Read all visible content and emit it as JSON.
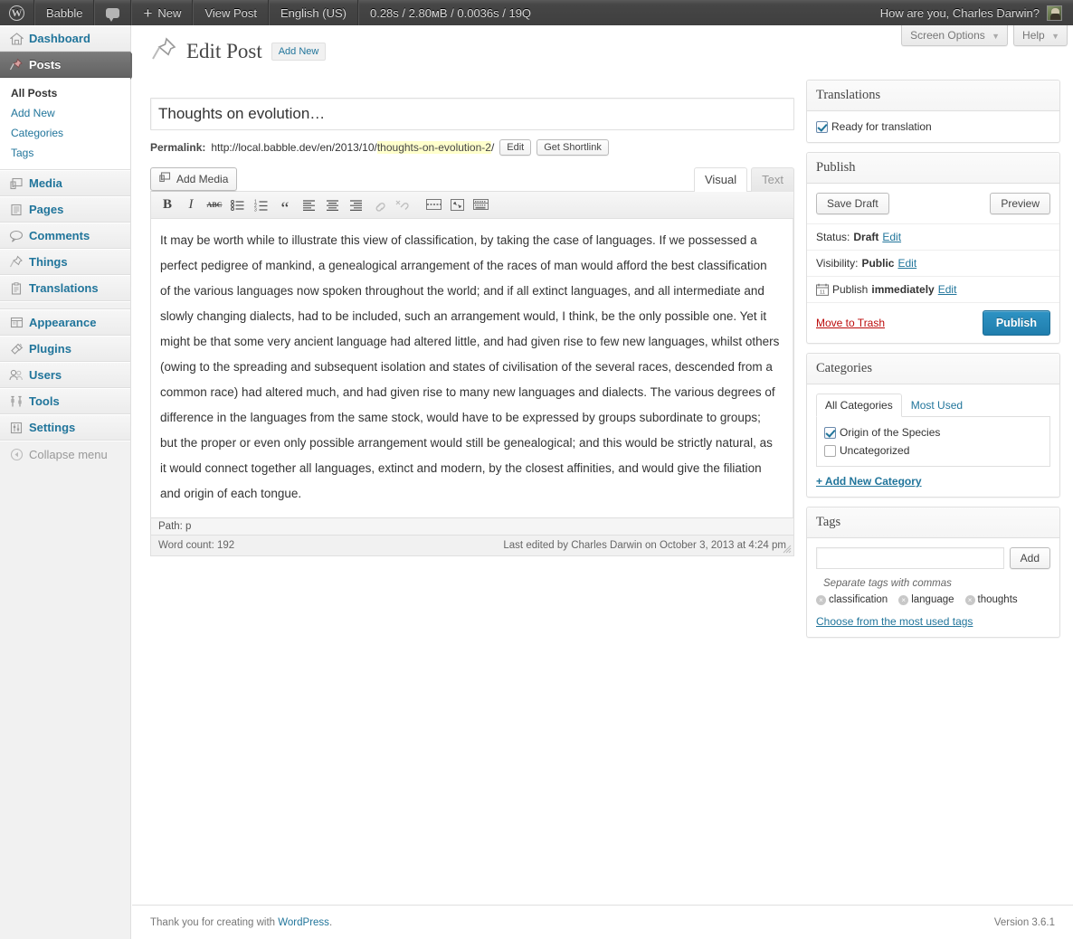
{
  "adminbar": {
    "logo_icon": "wordpress-logo-icon",
    "site_name": "Babble",
    "comments_icon": "comment-bubble-icon",
    "new_label": "New",
    "view_post_label": "View Post",
    "language_label": "English (US)",
    "debug_stats": "0.28s / 2.80мB / 0.0036s / 19Q",
    "greeting": "How are you, Charles Darwin?",
    "avatar_icon": "user-avatar-icon"
  },
  "screen_meta": {
    "screen_options_label": "Screen Options",
    "help_label": "Help",
    "caret": "▼"
  },
  "sidebar": {
    "items": [
      {
        "label": "Dashboard",
        "icon": "dashboard-home-icon",
        "current": false
      },
      {
        "label": "Posts",
        "icon": "pushpin-icon",
        "current": true
      },
      {
        "label": "Media",
        "icon": "media-images-icon",
        "current": false
      },
      {
        "label": "Pages",
        "icon": "pages-document-icon",
        "current": false
      },
      {
        "label": "Comments",
        "icon": "comment-bubble-icon",
        "current": false
      },
      {
        "label": "Things",
        "icon": "pushpin-icon",
        "current": false
      },
      {
        "label": "Translations",
        "icon": "clipboard-icon",
        "current": false
      },
      {
        "label": "Appearance",
        "icon": "appearance-layout-icon",
        "current": false
      },
      {
        "label": "Plugins",
        "icon": "plug-icon",
        "current": false
      },
      {
        "label": "Users",
        "icon": "users-icon",
        "current": false
      },
      {
        "label": "Tools",
        "icon": "tools-icon",
        "current": false
      },
      {
        "label": "Settings",
        "icon": "settings-sliders-icon",
        "current": false
      }
    ],
    "posts_submenu": [
      {
        "label": "All Posts",
        "current": true
      },
      {
        "label": "Add New",
        "current": false
      },
      {
        "label": "Categories",
        "current": false
      },
      {
        "label": "Tags",
        "current": false
      }
    ],
    "collapse_label": "Collapse menu",
    "collapse_icon": "collapse-arrow-icon"
  },
  "page": {
    "title": "Edit Post",
    "title_icon": "pushpin-icon",
    "add_new_label": "Add New"
  },
  "post": {
    "title_value": "Thoughts on evolution…",
    "title_placeholder": "Enter title here",
    "permalink_label": "Permalink:",
    "permalink_base": "http://local.babble.dev/en/2013/10/",
    "permalink_slug": "thoughts-on-evolution-2",
    "permalink_tail": "/",
    "edit_slug_label": "Edit",
    "shortlink_label": "Get Shortlink",
    "add_media_label": "Add Media",
    "add_media_icon": "add-media-icon",
    "tab_visual": "Visual",
    "tab_text": "Text",
    "active_tab": "Visual",
    "body_text": "It may be worth while to illustrate this view of classification, by taking the case of languages. If we possessed a perfect pedigree of mankind, a genealogical arrangement of the races of man would afford the best classification of the various languages now spoken throughout the world; and if all extinct languages, and all intermediate and slowly changing dialects, had to be included, such an arrangement would, I think, be the only possible one. Yet it might be that some very ancient language had altered little, and had given rise to few new languages, whilst others (owing to the spreading and subsequent isolation and states of civilisation of the several races, descended from a common race) had altered much, and had given rise to many new languages and dialects. The various degrees of difference in the languages from the same stock, would have to be expressed by groups subordinate to groups; but the proper or even only possible arrangement would still be genealogical; and this would be strictly natural, as it would connect together all languages, extinct and modern, by the closest affinities, and would give the filiation and origin of each tongue.",
    "path_label": "Path: p",
    "word_count_label": "Word count: 192",
    "last_edited_label": "Last edited by Charles Darwin on October 3, 2013 at 4:24 pm"
  },
  "toolbar_buttons": [
    {
      "name": "bold-icon",
      "glyph": "B"
    },
    {
      "name": "italic-icon",
      "glyph": "I"
    },
    {
      "name": "strikethrough-icon",
      "glyph": "ABC"
    },
    {
      "name": "unordered-list-icon",
      "glyph": ""
    },
    {
      "name": "ordered-list-icon",
      "glyph": ""
    },
    {
      "name": "blockquote-icon",
      "glyph": "“"
    },
    {
      "name": "align-left-icon",
      "glyph": ""
    },
    {
      "name": "align-center-icon",
      "glyph": ""
    },
    {
      "name": "align-right-icon",
      "glyph": ""
    },
    {
      "name": "insert-link-icon",
      "glyph": "",
      "disabled": true
    },
    {
      "name": "remove-link-icon",
      "glyph": "",
      "disabled": true
    },
    {
      "name": "insert-more-tag-icon",
      "glyph": ""
    },
    {
      "name": "fullscreen-icon",
      "glyph": ""
    },
    {
      "name": "kitchen-sink-icon",
      "glyph": ""
    }
  ],
  "translations_box": {
    "title": "Translations",
    "ready_label": "Ready for translation",
    "ready_checked": true
  },
  "publish_box": {
    "title": "Publish",
    "save_draft_label": "Save Draft",
    "preview_label": "Preview",
    "status_prefix": "Status:",
    "status_value": "Draft",
    "status_edit": "Edit",
    "visibility_prefix": "Visibility:",
    "visibility_value": "Public",
    "visibility_edit": "Edit",
    "schedule_icon": "calendar-icon",
    "schedule_prefix": "Publish",
    "schedule_value": "immediately",
    "schedule_edit": "Edit",
    "trash_label": "Move to Trash",
    "publish_label": "Publish"
  },
  "categories_box": {
    "title": "Categories",
    "tab_all": "All Categories",
    "tab_most_used": "Most Used",
    "active_tab": "All Categories",
    "items": [
      {
        "label": "Origin of the Species",
        "checked": true
      },
      {
        "label": "Uncategorized",
        "checked": false
      }
    ],
    "add_new_label": "+ Add New Category"
  },
  "tags_box": {
    "title": "Tags",
    "input_value": "",
    "input_placeholder": "",
    "add_label": "Add",
    "hint": "Separate tags with commas",
    "tags": [
      "classification",
      "language",
      "thoughts"
    ],
    "remove_icon": "remove-tag-icon",
    "cloud_link": "Choose from the most used tags"
  },
  "footer": {
    "thanks_prefix": "Thank you for creating with ",
    "wordpress_link": "WordPress",
    "thanks_suffix": ".",
    "version": "Version 3.6.1"
  },
  "colors": {
    "admin_bar": "#464646",
    "link_blue": "#21759b",
    "publish_blue": "#2e93c4",
    "trash_red": "#bc0b0b",
    "slug_highlight": "#ffffcc",
    "sidebar_bg": "#f1f1f1"
  }
}
